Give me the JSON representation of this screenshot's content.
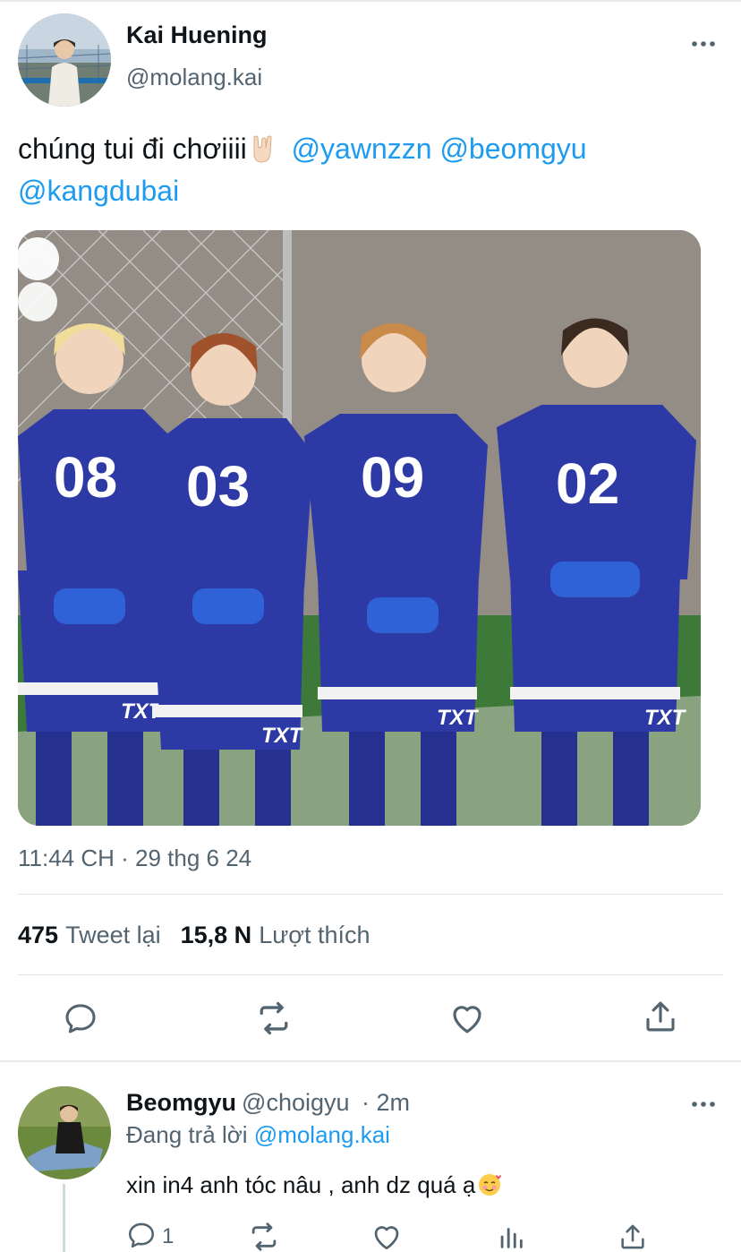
{
  "tweet": {
    "author_name": "Kai Huening",
    "author_handle": "@molang.kai",
    "text_prefix": "chúng tui đi chơiiii",
    "mentions": [
      "@yawnzzn",
      "@beomgyu",
      "@kangdubai"
    ],
    "photo": {
      "jersey_numbers": [
        "08",
        "03",
        "09",
        "02"
      ],
      "shorts_label": "TXT"
    },
    "timestamp": "11:44 CH · 29 thg 6 24",
    "retweet_count": "475",
    "retweet_label": "Tweet lại",
    "like_count": "15,8 N",
    "like_label": "Lượt thích"
  },
  "reply": {
    "author_name": "Beomgyu",
    "author_handle": "@choigyu",
    "time": "· 2m",
    "replying_label": "Đang trả lời",
    "replying_to": "@molang.kai",
    "text": "xin in4 anh tóc nâu , anh dz quá ạ",
    "reply_count": "1"
  },
  "colors": {
    "accent": "#1d9bf0",
    "secondary_text": "#536471",
    "icon": "#536471",
    "jersey": "#2d3aa6"
  },
  "icons": [
    "more-icon",
    "reply-icon",
    "retweet-icon",
    "like-icon",
    "share-icon",
    "analytics-icon"
  ]
}
